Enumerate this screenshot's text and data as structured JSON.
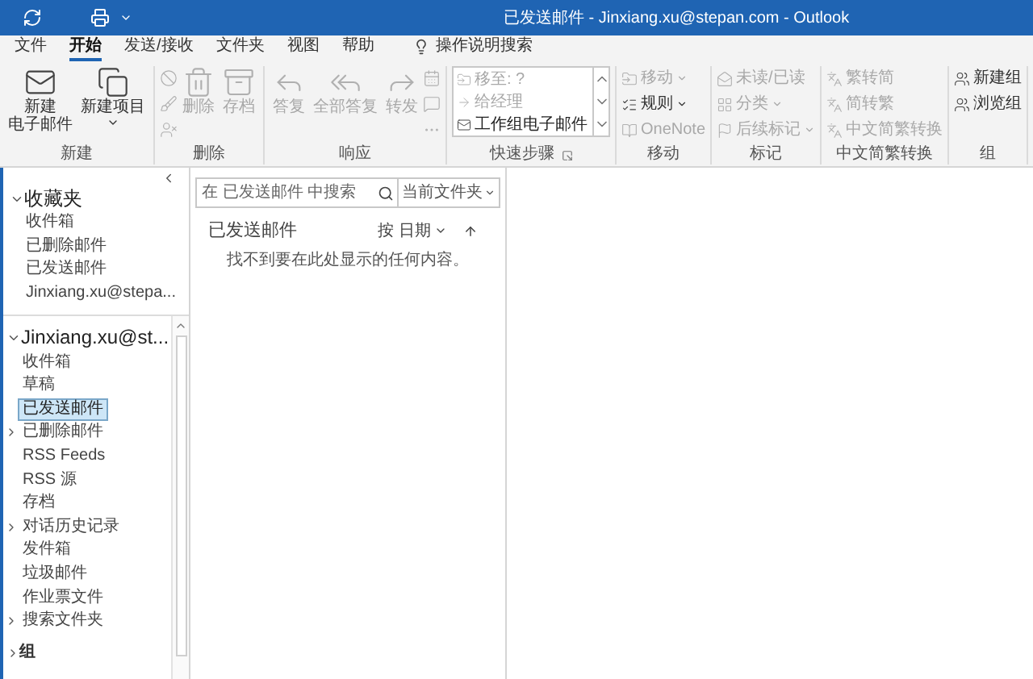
{
  "title_bar": {
    "title": "已发送邮件 - Jinxiang.xu@stepan.com - Outlook"
  },
  "tabs": [
    {
      "label": "文件",
      "selected": false
    },
    {
      "label": "开始",
      "selected": true
    },
    {
      "label": "发送/接收",
      "selected": false
    },
    {
      "label": "文件夹",
      "selected": false
    },
    {
      "label": "视图",
      "selected": false
    },
    {
      "label": "帮助",
      "selected": false
    }
  ],
  "tell_me": {
    "placeholder": "操作说明搜索"
  },
  "ribbon": {
    "groups": [
      {
        "label": "新建",
        "kind": "large",
        "items": [
          {
            "lines": [
              "新建",
              "电子邮件"
            ],
            "disabled": false,
            "dropdown": false
          },
          {
            "lines": [
              "新建项目"
            ],
            "disabled": false,
            "dropdown": true
          }
        ]
      },
      {
        "label": "删除",
        "kind": "large",
        "items": [
          {
            "lines": [
              "删除"
            ],
            "disabled": true,
            "dropdown": false
          },
          {
            "lines": [
              "存档"
            ],
            "disabled": true,
            "dropdown": false
          }
        ]
      },
      {
        "label": "响应",
        "kind": "large",
        "items": [
          {
            "lines": [
              "答复"
            ],
            "disabled": true,
            "dropdown": false
          },
          {
            "lines": [
              "全部答复"
            ],
            "disabled": true,
            "dropdown": false
          },
          {
            "lines": [
              "转发"
            ],
            "disabled": true,
            "dropdown": false
          }
        ]
      },
      {
        "label": "快速步骤",
        "kind": "quick",
        "items": [
          {
            "label": "移至: ?",
            "disabled": true
          },
          {
            "label": "给经理",
            "disabled": true
          },
          {
            "label": "工作组电子邮件",
            "disabled": false
          }
        ]
      },
      {
        "label": "移动",
        "kind": "small",
        "items": [
          {
            "label": "移动",
            "disabled": true,
            "dropdown": true
          },
          {
            "label": "规则",
            "disabled": false,
            "dropdown": true
          },
          {
            "label": "OneNote",
            "disabled": true,
            "dropdown": false
          }
        ]
      },
      {
        "label": "标记",
        "kind": "small",
        "items": [
          {
            "label": "未读/已读",
            "disabled": true,
            "dropdown": false
          },
          {
            "label": "分类",
            "disabled": true,
            "dropdown": true
          },
          {
            "label": "后续标记",
            "disabled": true,
            "dropdown": true
          }
        ]
      },
      {
        "label": "中文简繁转换",
        "kind": "small",
        "items": [
          {
            "label": "繁转简",
            "disabled": true,
            "dropdown": false
          },
          {
            "label": "简转繁",
            "disabled": true,
            "dropdown": false
          },
          {
            "label": "中文简繁转换",
            "disabled": true,
            "dropdown": false
          }
        ]
      },
      {
        "label": "组",
        "kind": "small",
        "items": [
          {
            "label": "新建组",
            "disabled": false,
            "dropdown": false
          },
          {
            "label": "浏览组",
            "disabled": false,
            "dropdown": false
          }
        ]
      }
    ]
  },
  "folder_pane": {
    "favorites": {
      "label": "收藏夹",
      "expanded": true,
      "items": [
        {
          "label": "收件箱",
          "selected": false,
          "expandable": false
        },
        {
          "label": "已删除邮件",
          "selected": false,
          "expandable": false
        },
        {
          "label": "已发送邮件",
          "selected": false,
          "expandable": false
        },
        {
          "label": "Jinxiang.xu@stepa...",
          "selected": false,
          "expandable": false
        }
      ]
    },
    "account": {
      "label": "Jinxiang.xu@st...",
      "expanded": true,
      "items": [
        {
          "label": "收件箱",
          "selected": false,
          "expandable": false
        },
        {
          "label": "草稿",
          "selected": false,
          "expandable": false
        },
        {
          "label": "已发送邮件",
          "selected": true,
          "expandable": false
        },
        {
          "label": "已删除邮件",
          "selected": false,
          "expandable": true
        },
        {
          "label": "RSS Feeds",
          "selected": false,
          "expandable": false
        },
        {
          "label": "RSS 源",
          "selected": false,
          "expandable": false
        },
        {
          "label": "存档",
          "selected": false,
          "expandable": false
        },
        {
          "label": "对话历史记录",
          "selected": false,
          "expandable": true
        },
        {
          "label": "发件箱",
          "selected": false,
          "expandable": false
        },
        {
          "label": "垃圾邮件",
          "selected": false,
          "expandable": false
        },
        {
          "label": "作业票文件",
          "selected": false,
          "expandable": false
        },
        {
          "label": "搜索文件夹",
          "selected": false,
          "expandable": true
        }
      ]
    },
    "groups": {
      "label": "组",
      "expanded": false
    }
  },
  "message_list": {
    "search": {
      "placeholder": "在 已发送邮件 中搜索",
      "scope": "当前文件夹"
    },
    "folder": "已发送邮件",
    "sort": "按 日期",
    "empty": "找不到要在此处显示的任何内容。"
  }
}
